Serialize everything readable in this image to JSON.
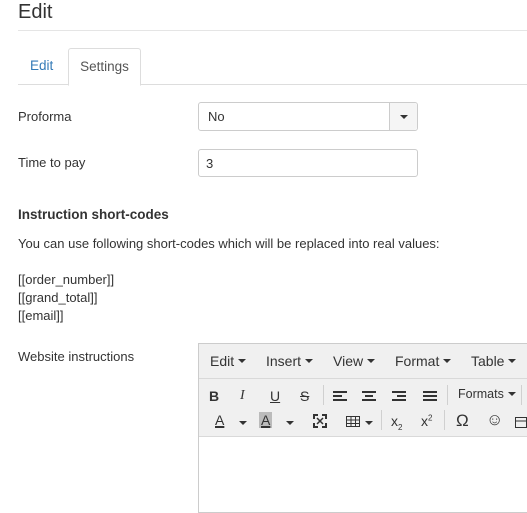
{
  "page": {
    "title": "Edit"
  },
  "tabs": [
    {
      "label": "Edit",
      "active": false
    },
    {
      "label": "Settings",
      "active": true
    }
  ],
  "form": {
    "proforma": {
      "label": "Proforma",
      "value": "No"
    },
    "time_to_pay": {
      "label": "Time to pay",
      "value": "3"
    },
    "instructions_section": {
      "heading": "Instruction short-codes",
      "help": "You can use following short-codes which will be replaced into real values:",
      "codes": [
        "[[order_number]]",
        "[[grand_total]]",
        "[[email]]"
      ]
    },
    "website_instructions": {
      "label": "Website instructions"
    }
  },
  "editor": {
    "menus": [
      "Edit",
      "Insert",
      "View",
      "Format",
      "Table"
    ],
    "toolbar": {
      "bold": "B",
      "italic": "I",
      "underline": "U",
      "strike": "S",
      "formats": "Formats",
      "text_color": "A",
      "bg_color": "A",
      "subscript": "x",
      "subscript_mark": "2",
      "superscript": "x",
      "superscript_mark": "2",
      "omega": "Ω",
      "emoji": "☺"
    },
    "icons": [
      "bold-icon",
      "italic-icon",
      "underline-icon",
      "strikethrough-icon",
      "align-left-icon",
      "align-center-icon",
      "align-right-icon",
      "align-justify-icon",
      "text-color-icon",
      "background-color-icon",
      "fullscreen-icon",
      "table-icon",
      "subscript-icon",
      "superscript-icon",
      "special-character-icon",
      "emoticons-icon"
    ]
  }
}
